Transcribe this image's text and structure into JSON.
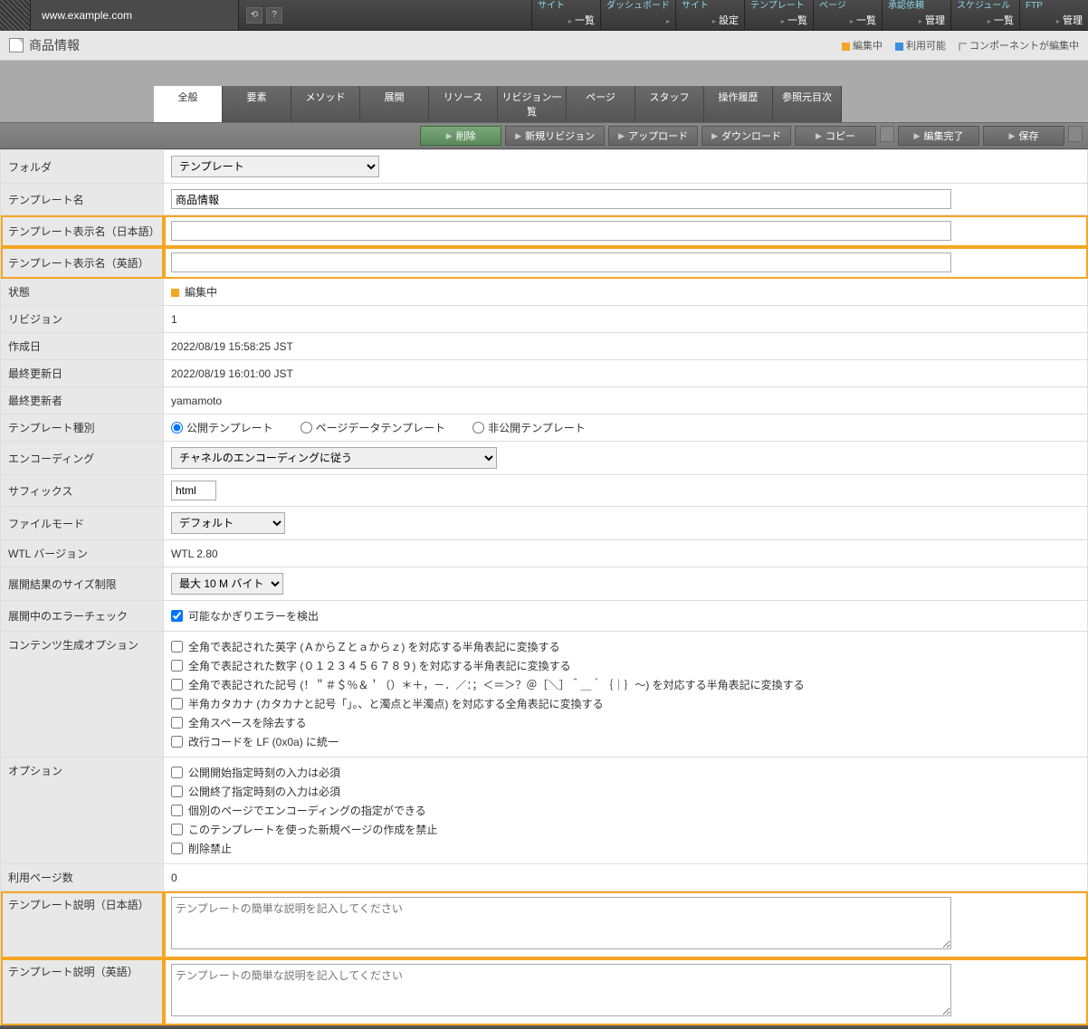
{
  "url": "www.example.com",
  "nav": [
    {
      "top": "サイト",
      "bottom": "一覧"
    },
    {
      "top": "ダッシュボード",
      "bottom": ""
    },
    {
      "top": "サイト",
      "bottom": "設定"
    },
    {
      "top": "テンプレート",
      "bottom": "一覧"
    },
    {
      "top": "ページ",
      "bottom": "一覧"
    },
    {
      "top": "承認依頼",
      "bottom": "管理"
    },
    {
      "top": "スケジュール",
      "bottom": "一覧"
    },
    {
      "top": "FTP",
      "bottom": "管理"
    }
  ],
  "page_title": "商品情報",
  "legend": {
    "editing": "編集中",
    "available": "利用可能",
    "component_editing": "コンポーネントが編集中"
  },
  "tabs": [
    "全般",
    "要素",
    "メソッド",
    "展開",
    "リソース",
    "リビジョン一覧",
    "ページ",
    "スタッフ",
    "操作履歴",
    "参照元目次"
  ],
  "active_tab": 0,
  "toolbar": {
    "delete": "削除",
    "new_revision": "新規リビジョン",
    "upload": "アップロード",
    "download": "ダウンロード",
    "copy": "コピー",
    "finish_edit": "編集完了",
    "save": "保存"
  },
  "labels": {
    "folder": "フォルダ",
    "template_name": "テンプレート名",
    "display_name_ja": "テンプレート表示名（日本語）",
    "display_name_en": "テンプレート表示名（英語）",
    "status": "状態",
    "revision": "リビジョン",
    "created": "作成日",
    "updated": "最終更新日",
    "updater": "最終更新者",
    "template_type": "テンプレート種別",
    "encoding": "エンコーディング",
    "suffix": "サフィックス",
    "file_mode": "ファイルモード",
    "wtl_version": "WTL バージョン",
    "size_limit": "展開結果のサイズ制限",
    "error_check": "展開中のエラーチェック",
    "content_gen": "コンテンツ生成オプション",
    "options": "オプション",
    "page_count": "利用ページ数",
    "desc_ja": "テンプレート説明（日本語）",
    "desc_en": "テンプレート説明（英語）"
  },
  "values": {
    "folder_selected": "テンプレート",
    "template_name": "商品情報",
    "display_name_ja": "",
    "display_name_en": "",
    "status": "編集中",
    "revision": "1",
    "created": "2022/08/19 15:58:25 JST",
    "updated": "2022/08/19 16:01:00 JST",
    "updater": "yamamoto",
    "template_type_options": [
      "公開テンプレート",
      "ページデータテンプレート",
      "非公開テンプレート"
    ],
    "template_type_selected": 0,
    "encoding_selected": "チャネルのエンコーディングに従う",
    "suffix": "html",
    "file_mode_selected": "デフォルト",
    "wtl_version": "WTL 2.80",
    "size_limit_selected": "最大 10 M バイト",
    "error_check_checked": true,
    "error_check_label": "可能なかぎりエラーを検出",
    "content_gen_options": [
      "全角で表記された英字 (ＡからＺとａからｚ) を対応する半角表記に変換する",
      "全角で表記された数字 (０１２３４５６７８９) を対応する半角表記に変換する",
      "全角で表記された記号 (！＂＃＄％＆＇（）＊＋，－．／：；＜＝＞？＠［＼］＾＿｀｛｜｝～) を対応する半角表記に変換する",
      "半角カタカナ (カタカナと記号「」。、と濁点と半濁点) を対応する全角表記に変換する",
      "全角スペースを除去する",
      "改行コードを LF (0x0a) に統一"
    ],
    "options_list": [
      "公開開始指定時刻の入力は必須",
      "公開終了指定時刻の入力は必須",
      "個別のページでエンコーディングの指定ができる",
      "このテンプレートを使った新規ページの作成を禁止",
      "削除禁止"
    ],
    "page_count": "0",
    "desc_placeholder": "テンプレートの簡単な説明を記入してください"
  }
}
